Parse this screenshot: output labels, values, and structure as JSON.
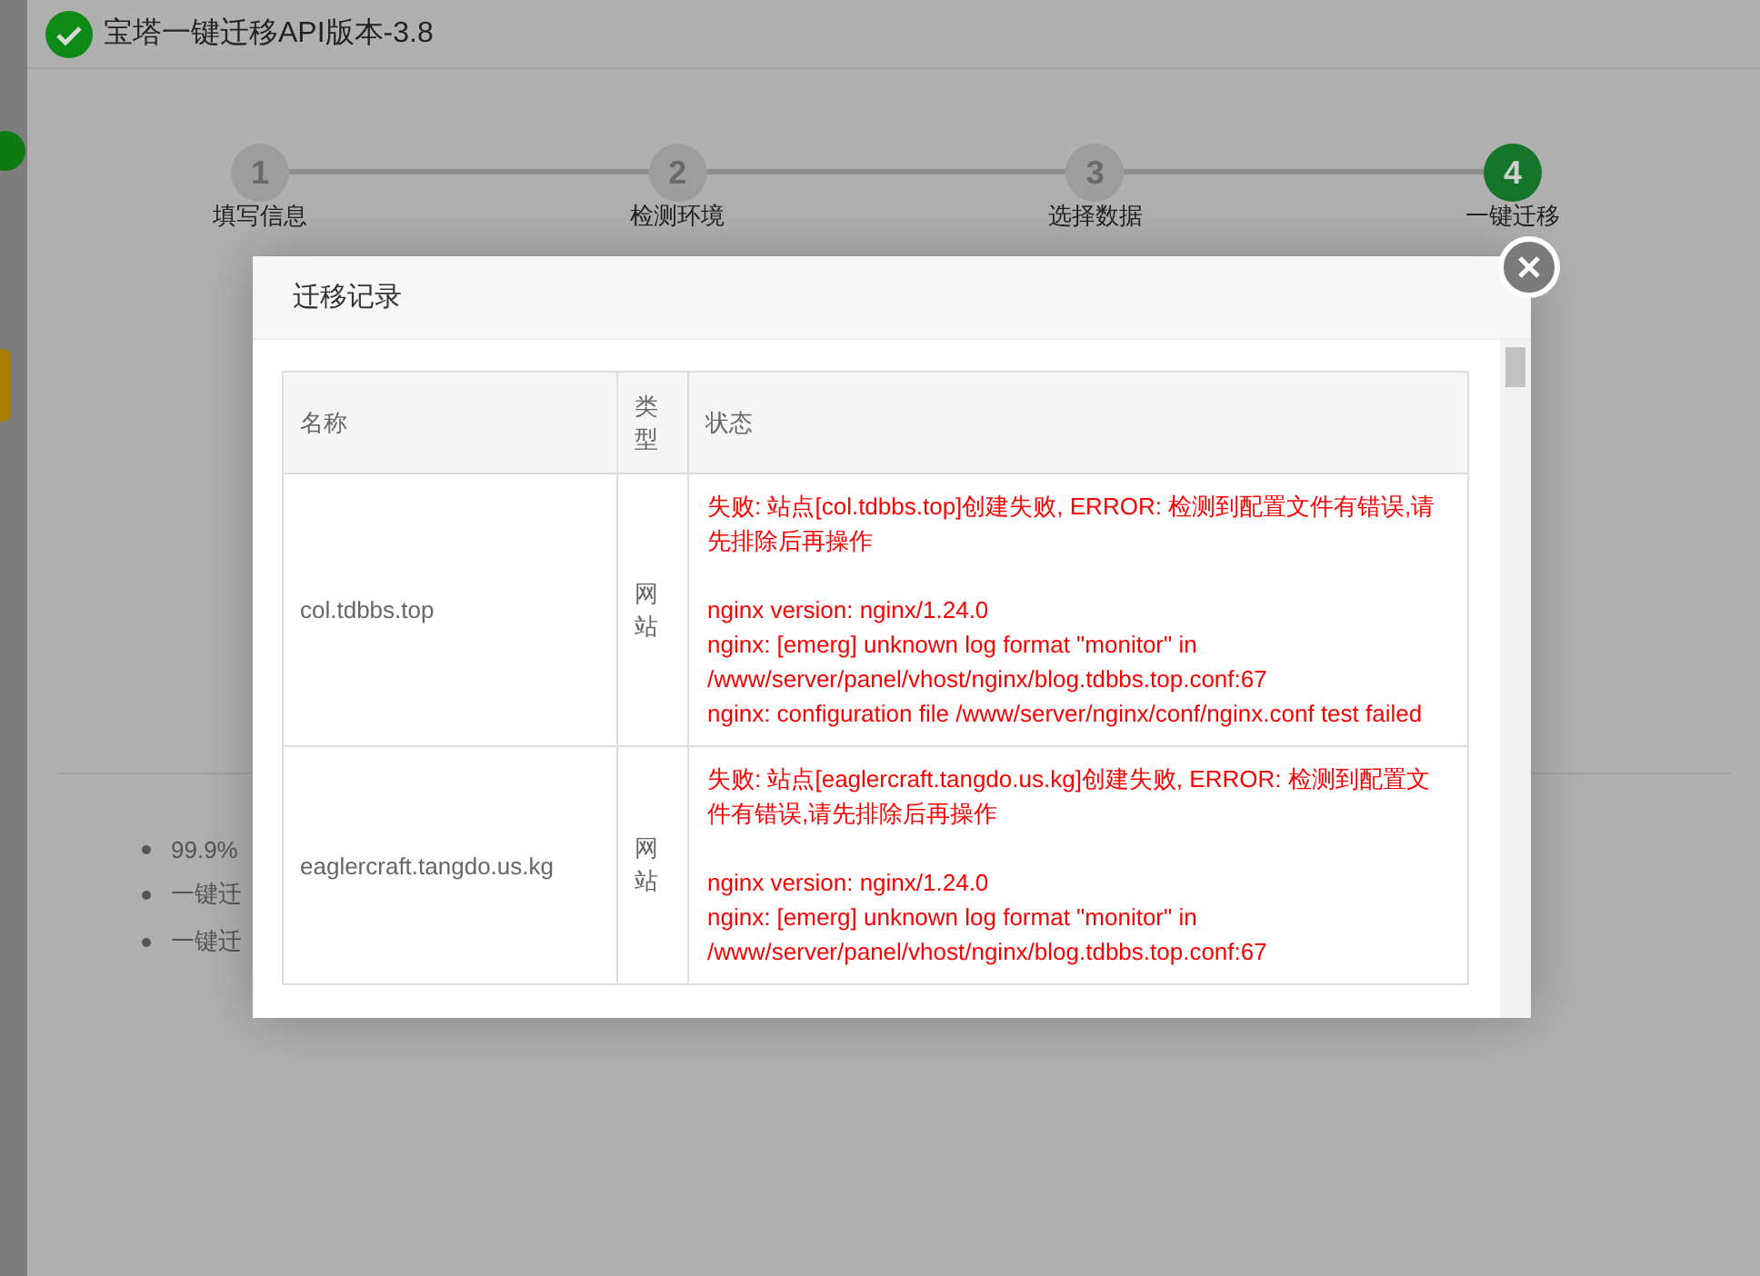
{
  "window": {
    "title": "宝塔一键迁移API版本-3.8"
  },
  "steps": [
    {
      "number": "1",
      "label": "填写信息",
      "active": false
    },
    {
      "number": "2",
      "label": "检测环境",
      "active": false
    },
    {
      "number": "3",
      "label": "选择数据",
      "active": false
    },
    {
      "number": "4",
      "label": "一键迁移",
      "active": true
    }
  ],
  "notes": [
    "99.9%",
    "一键迁",
    "一键迁"
  ],
  "dialog": {
    "title": "迁移记录",
    "table": {
      "columns": [
        "名称",
        "类型",
        "状态"
      ],
      "rows": [
        {
          "name": "col.tdbbs.top",
          "type": "网站",
          "error": "失败: 站点[col.tdbbs.top]创建失败, ERROR: 检测到配置文件有错误,请先排除后再操作",
          "details": [
            "nginx version: nginx/1.24.0",
            "nginx: [emerg] unknown log format \"monitor\" in /www/server/panel/vhost/nginx/blog.tdbbs.top.conf:67",
            "nginx: configuration file /www/server/nginx/conf/nginx.conf test failed"
          ]
        },
        {
          "name": "eaglercraft.tangdo.us.kg",
          "type": "网站",
          "error": "失败: 站点[eaglercraft.tangdo.us.kg]创建失败, ERROR: 检测到配置文件有错误,请先排除后再操作",
          "details": [
            "nginx version: nginx/1.24.0",
            "nginx: [emerg] unknown log format \"monitor\" in /www/server/panel/vhost/nginx/blog.tdbbs.top.conf:67"
          ]
        }
      ]
    }
  }
}
